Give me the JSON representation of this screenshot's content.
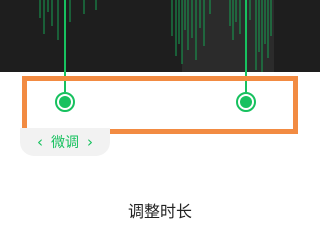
{
  "fine_tune": {
    "label": "微调"
  },
  "sheet": {
    "title": "调整时长"
  },
  "colors": {
    "accent": "#17c15f",
    "highlight": "#f28b42",
    "waveform_bg": "#1e1e1e"
  },
  "icons": {
    "left": "chevron-left-icon",
    "right": "chevron-right-icon"
  }
}
